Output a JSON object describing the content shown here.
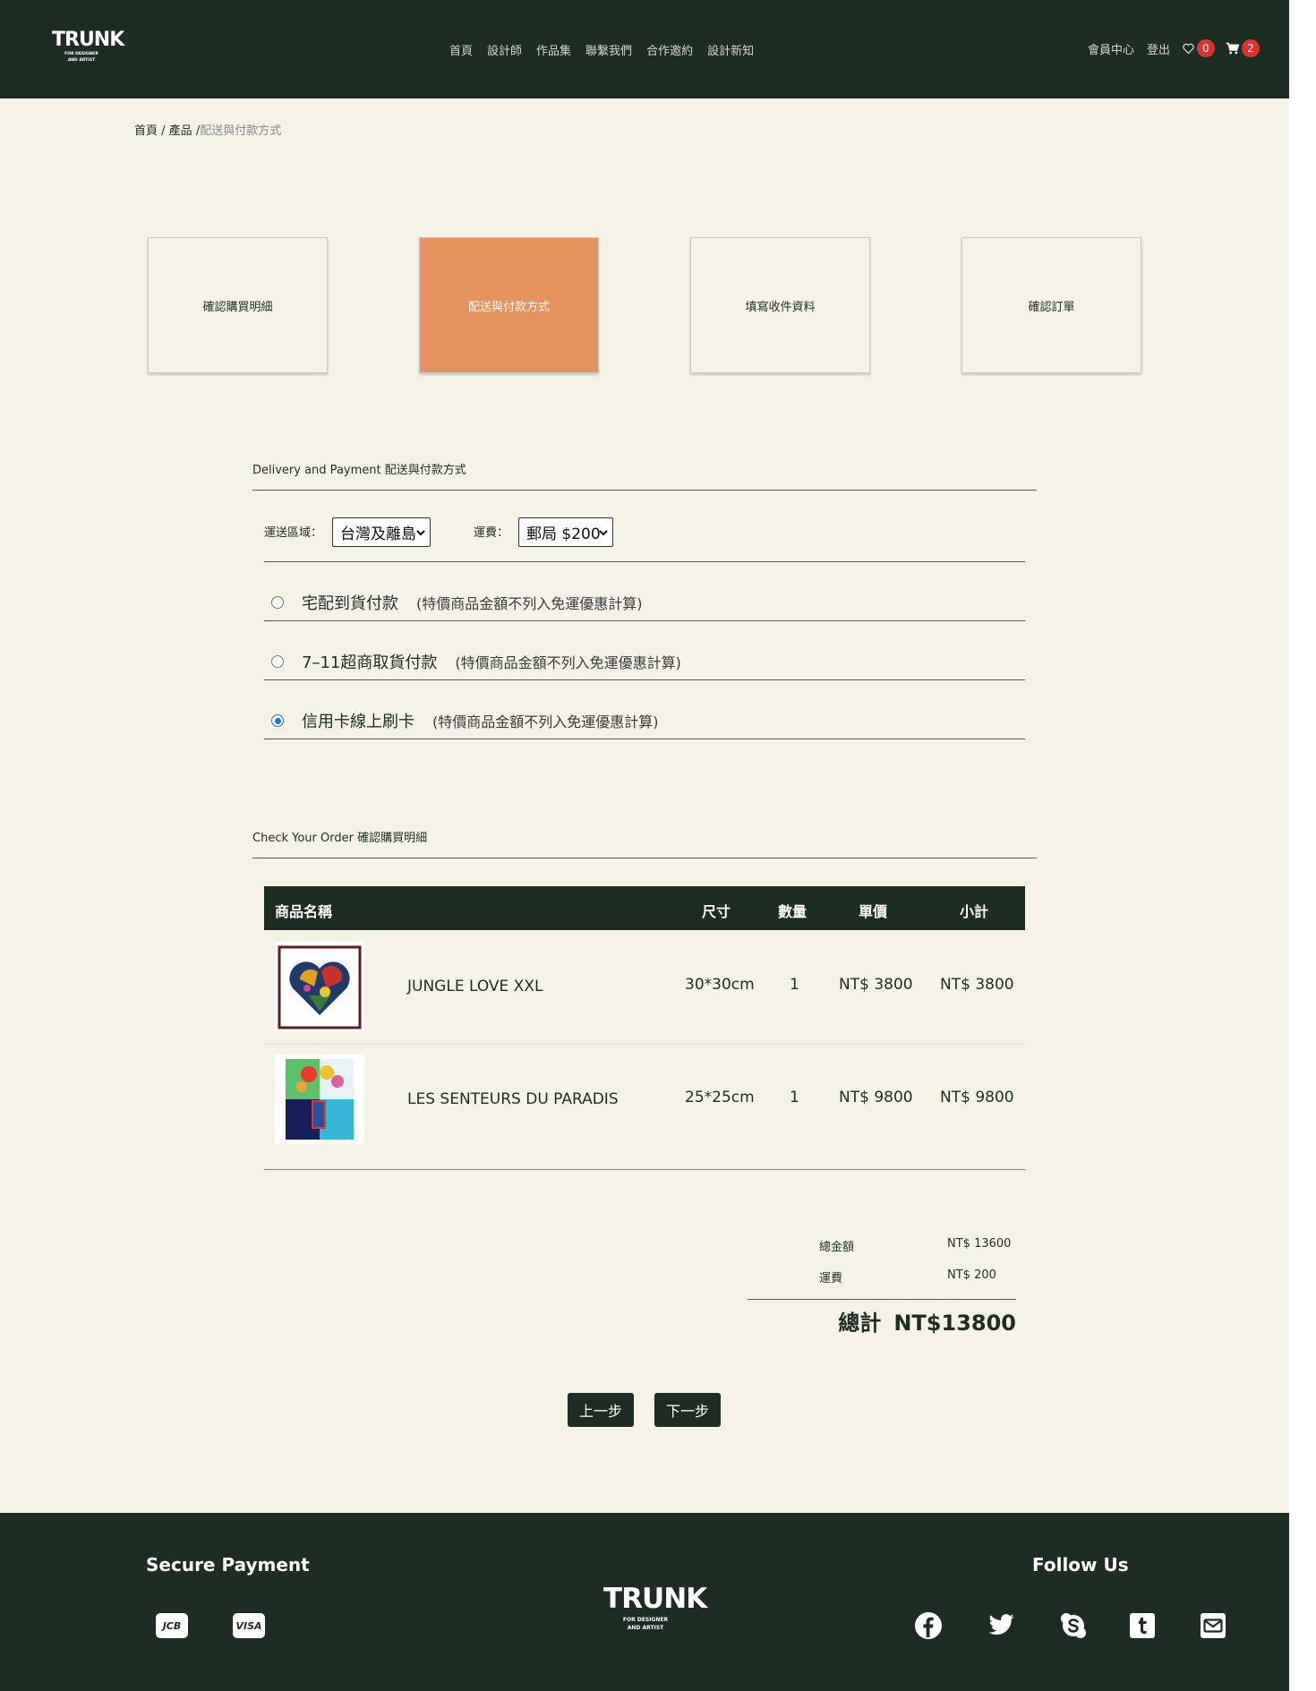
{
  "header": {
    "logo_word": "TRUNK",
    "logo_tag_line1": "FOR DESIGNER",
    "logo_tag_line2": "AND ARTIST",
    "nav": [
      "首頁",
      "設計師",
      "作品集",
      "聯繫我們",
      "合作邀約",
      "設計新知"
    ],
    "member_center": "會員中心",
    "logout": "登出",
    "wishlist_count": "0",
    "cart_count": "2"
  },
  "breadcrumb": {
    "home": "首頁",
    "sep1": " / ",
    "products": "產品",
    "sep2": " /",
    "current": "配送與付款方式"
  },
  "steps": [
    {
      "label": "確認購買明細"
    },
    {
      "label": "配送與付款方式"
    },
    {
      "label": "填寫收件資料"
    },
    {
      "label": "確認訂單"
    }
  ],
  "delivery": {
    "title": "Delivery and Payment 配送與付款方式",
    "region_label": "運送區域：",
    "region_value": "台灣及離島",
    "fee_label": "運費：",
    "fee_value": "郵局 $200",
    "options": [
      {
        "label": "宅配到貨付款",
        "note": "(特價商品金額不列入免運優惠計算)",
        "selected": false
      },
      {
        "label": "7–11超商取貨付款",
        "note": "(特價商品金額不列入免運優惠計算)",
        "selected": false
      },
      {
        "label": "信用卡線上刷卡",
        "note": "(特價商品金額不列入免運優惠計算)",
        "selected": true
      }
    ]
  },
  "order": {
    "title": "Check Your Order 確認購買明細",
    "columns": {
      "name": "商品名稱",
      "size": "尺寸",
      "qty": "數量",
      "price": "單價",
      "subtotal": "小計"
    },
    "items": [
      {
        "name": "JUNGLE LOVE XXL",
        "size": "30*30cm",
        "qty": "1",
        "price": "NT$ 3800",
        "subtotal": "NT$ 3800"
      },
      {
        "name": "LES SENTEURS DU PARADIS",
        "size": "25*25cm",
        "qty": "1",
        "price": "NT$ 9800",
        "subtotal": "NT$ 9800"
      }
    ]
  },
  "totals": {
    "amount_label": "總金額",
    "amount_value": "NT$ 13600",
    "shipping_label": "運費",
    "shipping_value": "NT$ 200",
    "grand_label": "總計",
    "grand_value": "NT$13800"
  },
  "buttons": {
    "prev": "上一步",
    "next": "下一步"
  },
  "footer": {
    "secure_payment": "Secure Payment",
    "payment_methods": [
      "JCB",
      "VISA"
    ],
    "follow_us": "Follow Us",
    "social": [
      "facebook-icon",
      "twitter-icon",
      "skype-icon",
      "tumblr-icon",
      "email-icon"
    ]
  },
  "colors": {
    "brand_dark": "#1e2d24",
    "page_bg": "#f5f2e8",
    "active_step": "#e5935e",
    "badge": "#e0322d"
  }
}
